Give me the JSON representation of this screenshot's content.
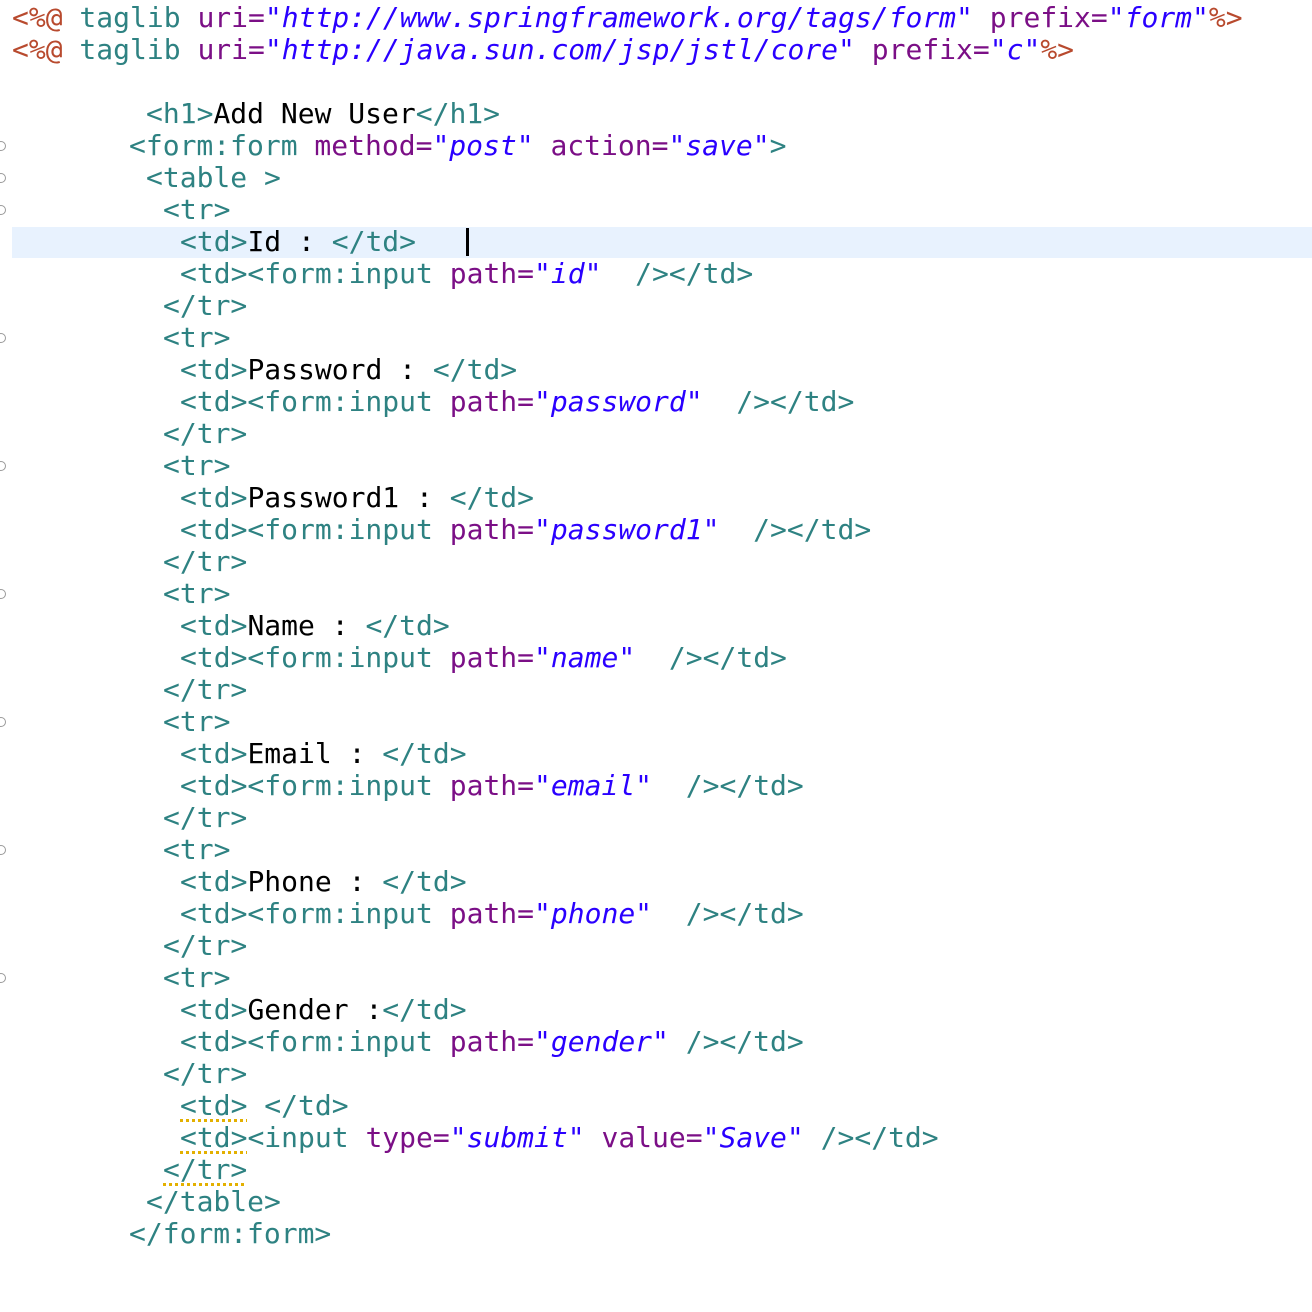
{
  "editor": {
    "lines": [
      [
        "<%@",
        " taglib ",
        "uri=",
        "\"http://www.springframework.org/tags/form\"",
        " prefix=",
        "\"form\"",
        "%>"
      ],
      [
        "<%@",
        " taglib ",
        "uri=",
        "\"http://java.sun.com/jsp/jstl/core\"",
        " prefix=",
        "\"c\"",
        "%>"
      ],
      [
        "<h1>",
        "Add New User",
        "</h1>"
      ],
      [
        "<form:form",
        " method=",
        "\"post\"",
        " action=",
        "\"save\"",
        ">"
      ],
      [
        "<table >"
      ],
      [
        "<tr>"
      ],
      [
        "<td>",
        "Id : ",
        "</td>"
      ],
      [
        "<td><form:input",
        " path=",
        "\"id\"",
        "  /></td>"
      ],
      [
        "</tr>"
      ],
      [
        "<tr>"
      ],
      [
        "<td>",
        "Password : ",
        "</td>"
      ],
      [
        "<td><form:input",
        " path=",
        "\"password\"",
        "  /></td>"
      ],
      [
        "</tr>"
      ],
      [
        "<tr>"
      ],
      [
        "<td>",
        "Password1 : ",
        "</td>"
      ],
      [
        "<td><form:input",
        " path=",
        "\"password1\"",
        "  /></td>"
      ],
      [
        "</tr>"
      ],
      [
        "<tr>"
      ],
      [
        "<td>",
        "Name : ",
        "</td>"
      ],
      [
        "<td><form:input",
        " path=",
        "\"name\"",
        "  /></td>"
      ],
      [
        "</tr>"
      ],
      [
        "<tr>"
      ],
      [
        "<td>",
        "Email : ",
        "</td>"
      ],
      [
        "<td><form:input",
        " path=",
        "\"email\"",
        "  /></td>"
      ],
      [
        "</tr>"
      ],
      [
        "<tr>"
      ],
      [
        "<td>",
        "Phone : ",
        "</td>"
      ],
      [
        "<td><form:input",
        " path=",
        "\"phone\"",
        "  /></td>"
      ],
      [
        "</tr>"
      ],
      [
        "<tr>"
      ],
      [
        "<td>",
        "Gender :",
        "</td>"
      ],
      [
        "<td><form:input",
        " path=",
        "\"gender\"",
        " /></td>"
      ],
      [
        "</tr>"
      ],
      [
        "<td>",
        " </td>"
      ],
      [
        "<td>",
        "<input",
        " type=",
        "\"submit\"",
        " value=",
        "\"Save\"",
        " /></td>"
      ],
      [
        "</tr>"
      ],
      [
        "</table>"
      ],
      [
        "</form:form>"
      ]
    ]
  },
  "colors": {
    "tag": "#2e8282",
    "attribute": "#7b0f86",
    "string": "#2a00ff",
    "directive": "#b84a2e",
    "text": "#000000",
    "current_line": "#e8f2fe",
    "warning_underline": "#e3b000"
  },
  "icons": [
    "fold-marker-icon",
    "text-caret-icon"
  ]
}
